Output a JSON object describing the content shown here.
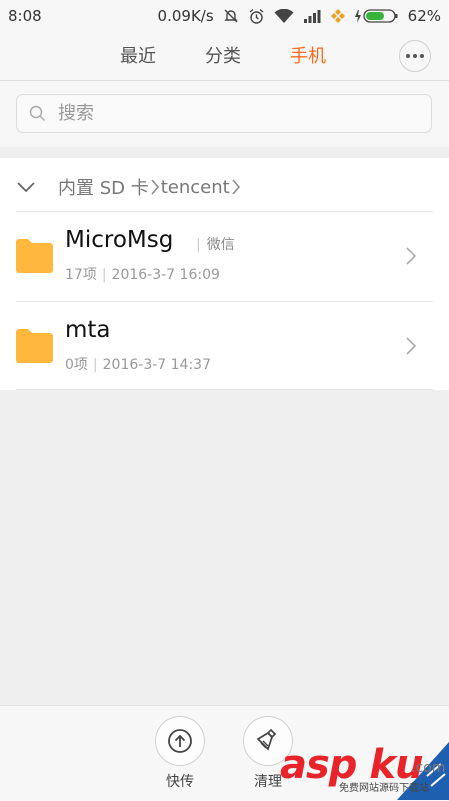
{
  "status_bar": {
    "time": "8:08",
    "speed": "0.09K/s",
    "battery": "62%",
    "icons": [
      "bell-off-icon",
      "alarm-icon",
      "wifi-icon",
      "signal-icon",
      "app-icon",
      "charging-icon",
      "battery-icon"
    ]
  },
  "tabs": [
    {
      "label": "最近",
      "active": false
    },
    {
      "label": "分类",
      "active": false
    },
    {
      "label": "手机",
      "active": true
    }
  ],
  "search": {
    "placeholder": "搜索",
    "value": ""
  },
  "breadcrumb": {
    "items": [
      "内置 SD 卡",
      "tencent"
    ]
  },
  "files": [
    {
      "name": "MicroMsg",
      "tag": "微信",
      "count": "17项",
      "date": "2016-3-7 16:09"
    },
    {
      "name": "mta",
      "tag": "",
      "count": "0项",
      "date": "2016-3-7 14:37"
    }
  ],
  "bottom_actions": [
    {
      "label": "快传",
      "icon": "upload-icon"
    },
    {
      "label": "清理",
      "icon": "broom-icon"
    }
  ],
  "watermark": {
    "text": "asp ku",
    "suffix": ".com",
    "subtitle": "免费网站源码下载站"
  },
  "colors": {
    "accent": "#ff6a1a",
    "folder": "#ffb83d"
  }
}
